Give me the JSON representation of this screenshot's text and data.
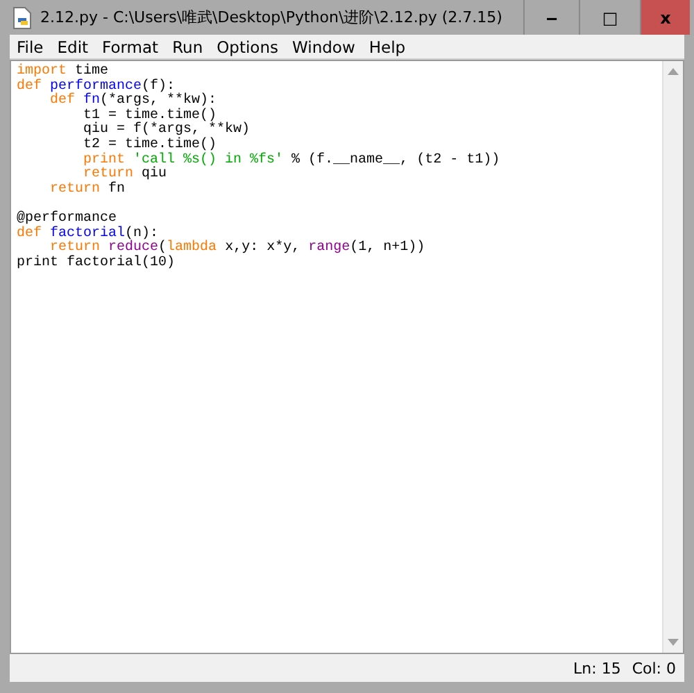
{
  "window": {
    "title": "2.12.py - C:\\Users\\唯武\\Desktop\\Python\\进阶\\2.12.py (2.7.15)",
    "controls": [
      {
        "kind": "minimize",
        "text": "‒"
      },
      {
        "kind": "maximize",
        "text": "□"
      },
      {
        "kind": "close",
        "text": "x"
      }
    ]
  },
  "menu": [
    "File",
    "Edit",
    "Format",
    "Run",
    "Options",
    "Window",
    "Help"
  ],
  "code_lines": [
    {
      "tokens": [
        {
          "kind": "keyword",
          "text": "import"
        },
        {
          "kind": "plain",
          "text": " time"
        }
      ]
    },
    {
      "tokens": [
        {
          "kind": "keyword",
          "text": "def"
        },
        {
          "kind": "definition",
          "text": " performance"
        },
        {
          "kind": "plain",
          "text": "(f):"
        }
      ]
    },
    {
      "tokens": [
        {
          "kind": "keyword",
          "text": "    def"
        },
        {
          "kind": "definition",
          "text": " fn"
        },
        {
          "kind": "plain",
          "text": "(*args, **kw):"
        }
      ]
    },
    {
      "tokens": [
        {
          "kind": "plain",
          "text": "        t1 = time.time()"
        }
      ]
    },
    {
      "tokens": [
        {
          "kind": "plain",
          "text": "        qiu = f(*args, **kw)"
        }
      ]
    },
    {
      "tokens": [
        {
          "kind": "plain",
          "text": "        t2 = time.time()"
        }
      ]
    },
    {
      "tokens": [
        {
          "kind": "keyword",
          "text": "        print"
        },
        {
          "kind": "string",
          "text": " 'call %s() in %fs'"
        },
        {
          "kind": "plain",
          "text": " % (f.__name__, (t2 - t1))"
        }
      ]
    },
    {
      "tokens": [
        {
          "kind": "keyword",
          "text": "        return"
        },
        {
          "kind": "plain",
          "text": " qiu"
        }
      ]
    },
    {
      "tokens": [
        {
          "kind": "keyword",
          "text": "    return"
        },
        {
          "kind": "plain",
          "text": " fn"
        }
      ]
    },
    {
      "kind": "blank"
    },
    {
      "tokens": [
        {
          "kind": "plain",
          "text": "@performance"
        }
      ]
    },
    {
      "tokens": [
        {
          "kind": "keyword",
          "text": "def"
        },
        {
          "kind": "definition",
          "text": " factorial"
        },
        {
          "kind": "plain",
          "text": "(n):"
        }
      ]
    },
    {
      "tokens": [
        {
          "kind": "keyword",
          "text": "    return"
        },
        {
          "kind": "builtin",
          "text": " reduce"
        },
        {
          "kind": "plain",
          "text": "("
        },
        {
          "kind": "keyword",
          "text": "lambda"
        },
        {
          "kind": "plain",
          "text": " x,y: x*y, "
        },
        {
          "kind": "builtin",
          "text": "range"
        },
        {
          "kind": "plain",
          "text": "(1, n+1))"
        }
      ]
    },
    {
      "tokens": [
        {
          "kind": "plain",
          "text": "print factorial(10)"
        }
      ]
    }
  ],
  "status_bar": {
    "line": "Ln: 15",
    "column": "Col: 0"
  }
}
